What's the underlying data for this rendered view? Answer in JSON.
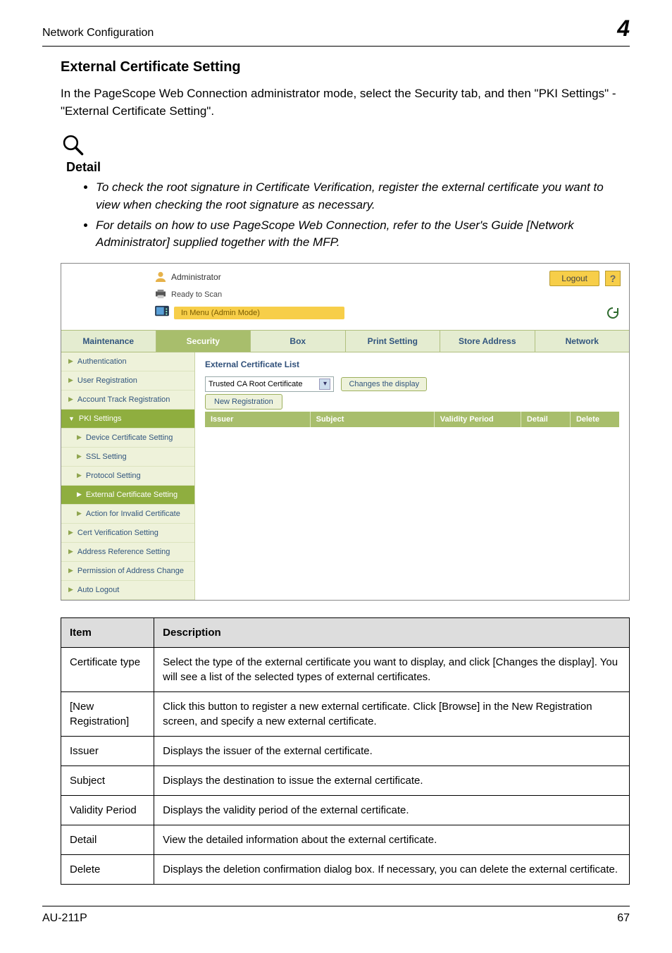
{
  "header": {
    "left": "Network Configuration",
    "right": "4"
  },
  "section_heading": "External Certificate Setting",
  "intro": "In the PageScope Web Connection administrator mode, select the Security tab, and then \"PKI Settings\" - \"External Certificate Setting\".",
  "detail_label": "Detail",
  "detail_items": [
    "To check the root signature in Certificate Verification, register the external certificate you want to view when checking the root signature as necessary.",
    "For details on how to use PageScope Web Connection, refer to the User's Guide [Network Administrator] supplied together with the MFP."
  ],
  "screenshot": {
    "administrator": "Administrator",
    "logout": "Logout",
    "help_glyph": "?",
    "ready": "Ready to Scan",
    "menumode": "In Menu (Admin Mode)",
    "tabs": [
      "Maintenance",
      "Security",
      "Box",
      "Print Setting",
      "Store Address",
      "Network"
    ],
    "active_tab_index": 1,
    "sidebar": [
      {
        "label": "Authentication"
      },
      {
        "label": "User Registration"
      },
      {
        "label": "Account Track Registration"
      },
      {
        "label": "PKI Settings",
        "dark": true
      },
      {
        "label": "Device Certificate Setting",
        "sub": true
      },
      {
        "label": "SSL Setting",
        "sub": true
      },
      {
        "label": "Protocol Setting",
        "sub": true
      },
      {
        "label": "External Certificate Setting",
        "sub": true,
        "selected": true
      },
      {
        "label": "Action for Invalid Certificate",
        "sub": true
      },
      {
        "label": "Cert Verification Setting"
      },
      {
        "label": "Address Reference Setting"
      },
      {
        "label": "Permission of Address Change"
      },
      {
        "label": "Auto Logout"
      }
    ],
    "main": {
      "title": "External Certificate List",
      "select_value": "Trusted CA Root Certificate",
      "changes_btn": "Changes the display",
      "newreg_btn": "New Registration",
      "columns": [
        "Issuer",
        "Subject",
        "Validity Period",
        "Detail",
        "Delete"
      ]
    }
  },
  "table": {
    "headers": [
      "Item",
      "Description"
    ],
    "rows": [
      {
        "item": "Certificate type",
        "desc": "Select the type of the external certificate you want to display, and click [Changes the display]. You will see a list of the selected types of external certificates."
      },
      {
        "item": "[New Registration]",
        "desc": "Click this button to register a new external certificate. Click [Browse] in the New Registration screen, and specify a new external certificate."
      },
      {
        "item": "Issuer",
        "desc": "Displays the issuer of the external certificate."
      },
      {
        "item": "Subject",
        "desc": "Displays the destination to issue the external certificate."
      },
      {
        "item": "Validity Period",
        "desc": "Displays the validity period of the external certificate."
      },
      {
        "item": "Detail",
        "desc": "View the detailed information about the external certificate."
      },
      {
        "item": "Delete",
        "desc": "Displays the deletion confirmation dialog box. If necessary, you can delete the external certificate."
      }
    ]
  },
  "footer": {
    "left": "AU-211P",
    "right": "67"
  }
}
